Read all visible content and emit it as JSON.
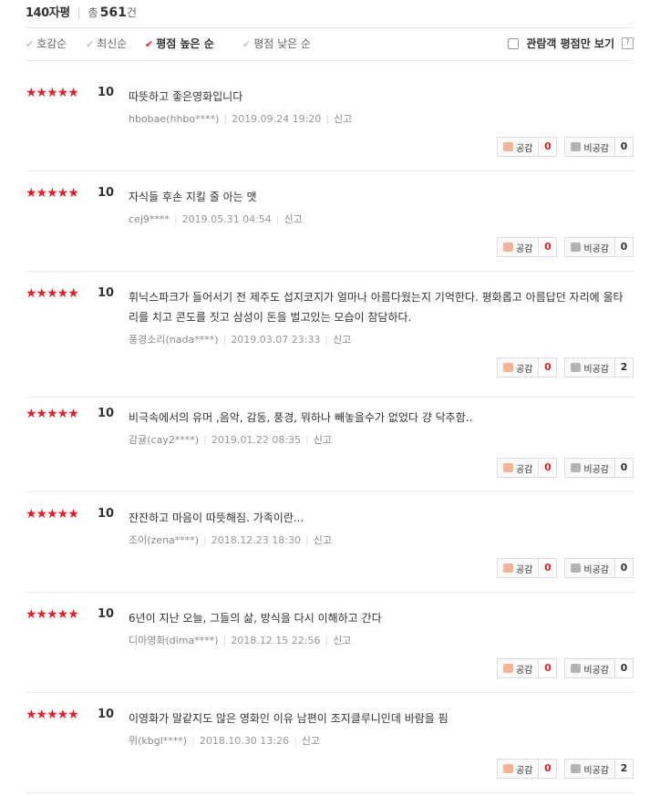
{
  "header": {
    "title": "140자평",
    "total_label": "총",
    "total_count": "561",
    "total_unit": "건"
  },
  "sort": {
    "options": [
      {
        "label": "호감순",
        "active": false
      },
      {
        "label": "최신순",
        "active": false
      },
      {
        "label": "평점 높은 순",
        "active": true
      },
      {
        "label": "평점 낮은 순",
        "active": false
      }
    ],
    "filter_label": "관람객 평점만 보기",
    "help": "?"
  },
  "buttons": {
    "like": "공감",
    "dislike": "비공감",
    "report": "신고"
  },
  "stars_text": "★★★★★",
  "reviews": [
    {
      "score": "10",
      "text": "따뜻하고 좋은영화입니다",
      "author": "hbobae(hhbo****)",
      "date": "2019.09.24 19:20",
      "likes": "0",
      "dislikes": "0"
    },
    {
      "score": "10",
      "text": "자식들 후손 지킬 줄 아는 맷",
      "author": "cej9****",
      "date": "2019.05.31 04:54",
      "likes": "0",
      "dislikes": "0"
    },
    {
      "score": "10",
      "text": "휘닉스파크가 들어서기 전 제주도 섭지코지가 얼마나 아름다웠는지 기억한다. 평화롭고 아름답던 자리에 울타리를 치고 콘도를 짓고 삼성이 돈을 벌고있는 모습이 참담하다.",
      "author": "풍경소리(nada****)",
      "date": "2019.03.07 23:33",
      "likes": "0",
      "dislikes": "2"
    },
    {
      "score": "10",
      "text": "비극속에서의 유머 ,음악, 감동, 풍경, 뭐하나 빼놓을수가 없었다 걍 닥추함..",
      "author": "감귤(cay2****)",
      "date": "2019.01.22 08:35",
      "likes": "0",
      "dislikes": "0"
    },
    {
      "score": "10",
      "text": "잔잔하고 마음이 따뜻해짐. 가족이란...",
      "author": "조이(zena****)",
      "date": "2018.12.23 18:30",
      "likes": "0",
      "dislikes": "0"
    },
    {
      "score": "10",
      "text": "6년이 지난 오늘, 그들의 삶, 방식을 다시 이해하고 간다",
      "author": "디마영화(dima****)",
      "date": "2018.12.15 22:56",
      "likes": "0",
      "dislikes": "0"
    },
    {
      "score": "10",
      "text": "이영화가 말같지도 않은 영화인 이유 남편이 조지클루니인데 바람을 핌",
      "author": "뮈(kbgl****)",
      "date": "2018.10.30 13:26",
      "likes": "0",
      "dislikes": "2"
    }
  ]
}
